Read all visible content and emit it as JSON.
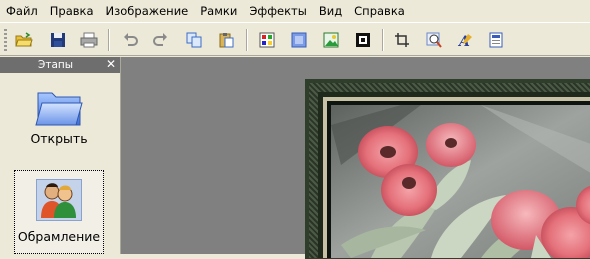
{
  "menu": {
    "items": [
      "Файл",
      "Правка",
      "Изображение",
      "Рамки",
      "Эффекты",
      "Вид",
      "Справка"
    ]
  },
  "toolbar": {
    "buttons": [
      {
        "name": "open-folder-icon"
      },
      {
        "name": "save-icon"
      },
      {
        "name": "print-icon"
      },
      {
        "name": "undo-icon"
      },
      {
        "name": "redo-icon"
      },
      {
        "name": "copy-icon"
      },
      {
        "name": "paste-icon"
      },
      {
        "name": "color-palette-icon"
      },
      {
        "name": "fill-icon"
      },
      {
        "name": "image-icon"
      },
      {
        "name": "frame-icon"
      },
      {
        "name": "crop-icon"
      },
      {
        "name": "zoom-icon"
      },
      {
        "name": "text-icon"
      },
      {
        "name": "caption-icon"
      }
    ]
  },
  "sidebar": {
    "title": "Этапы",
    "steps": [
      {
        "label": "Открыть"
      },
      {
        "label": "Обрамление"
      }
    ]
  },
  "colors": {
    "panel": "#ece9d8",
    "panel_header": "#6e6e6e",
    "workspace": "#808080",
    "frame_dark": "#2a3527",
    "frame_light": "#c7c2a6",
    "poppy": "#e4707a"
  }
}
